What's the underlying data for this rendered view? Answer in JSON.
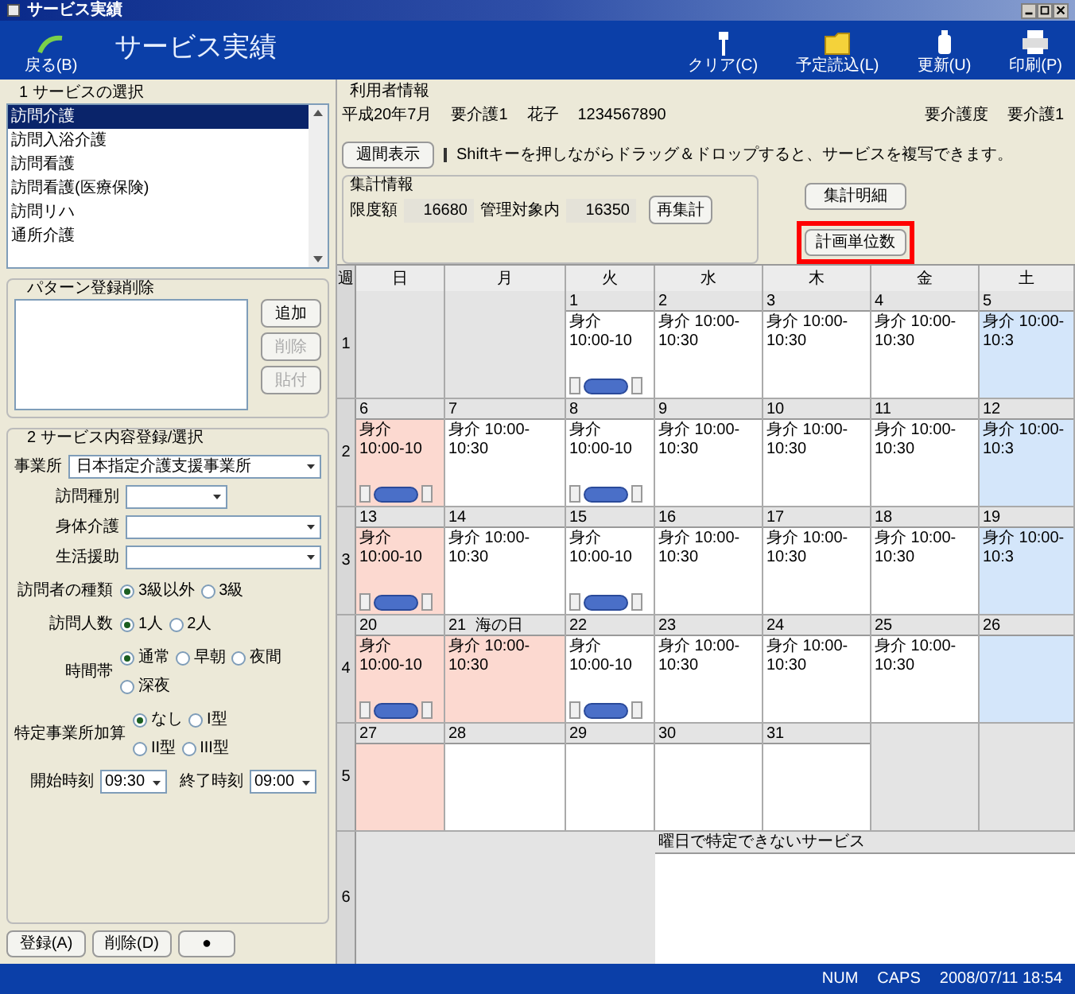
{
  "window": {
    "title": "サービス実績"
  },
  "toolbar": {
    "back": "戻る(B)",
    "title": "サービス実績",
    "buttons": [
      {
        "label": "クリア(C)",
        "kind": "clear"
      },
      {
        "label": "予定読込(L)",
        "kind": "folder"
      },
      {
        "label": "更新(U)",
        "kind": "update"
      },
      {
        "label": "印刷(P)",
        "kind": "print"
      }
    ]
  },
  "service_select": {
    "heading": "1 サービスの選択",
    "items": [
      {
        "label": "訪問介護",
        "selected": true
      },
      {
        "label": "訪問入浴介護",
        "selected": false
      },
      {
        "label": "訪問看護",
        "selected": false
      },
      {
        "label": "訪問看護(医療保険)",
        "selected": false
      },
      {
        "label": "訪問リハ",
        "selected": false
      },
      {
        "label": "通所介護",
        "selected": false
      }
    ]
  },
  "pattern": {
    "heading": "パターン登録削除",
    "buttons": [
      {
        "label": "追加",
        "disabled": false
      },
      {
        "label": "削除",
        "disabled": true
      },
      {
        "label": "貼付",
        "disabled": true
      }
    ]
  },
  "service_content": {
    "heading": "2 サービス内容登録/選択",
    "office": {
      "label": "事業所",
      "value": "日本指定介護支援事業所"
    },
    "selects": [
      {
        "label": "訪問種別",
        "kind": "short"
      },
      {
        "label": "身体介護",
        "kind": "wide"
      },
      {
        "label": "生活援助",
        "kind": "wide"
      }
    ],
    "radio_groups": [
      {
        "label": "訪問者の種類",
        "options": [
          {
            "label": "3級以外",
            "selected": true
          },
          {
            "label": "3級",
            "selected": false
          }
        ]
      },
      {
        "label": "訪問人数",
        "options": [
          {
            "label": "1人",
            "selected": true
          },
          {
            "label": "2人",
            "selected": false
          }
        ]
      },
      {
        "label": "時間帯",
        "options": [
          {
            "label": "通常",
            "selected": true
          },
          {
            "label": "早朝",
            "selected": false
          },
          {
            "label": "夜間",
            "selected": false
          },
          {
            "label": "深夜",
            "selected": false
          }
        ]
      },
      {
        "label": "特定事業所加算",
        "options": [
          {
            "label": "なし",
            "selected": true
          },
          {
            "label": "I型",
            "selected": false
          },
          {
            "label": "II型",
            "selected": false
          },
          {
            "label": "III型",
            "selected": false
          }
        ]
      }
    ],
    "times": [
      {
        "label": "開始時刻",
        "value": "09:30"
      },
      {
        "label": "終了時刻",
        "value": "09:00"
      }
    ]
  },
  "bottom_buttons": [
    "登録(A)",
    "削除(D)",
    "●"
  ],
  "user_info": {
    "heading": "利用者情報",
    "fields": [
      "平成20年7月",
      "要介護1",
      "花子",
      "1234567890"
    ],
    "care_level_label": "要介護度",
    "care_level": "要介護1"
  },
  "week_view_button": "週間表示",
  "hint": "Shiftキーを押しながらドラッグ＆ドロップすると、サービスを複写できます。",
  "totals": {
    "heading": "集計情報",
    "items": [
      {
        "label": "限度額",
        "value": "16680"
      },
      {
        "label": "管理対象内",
        "value": "16350"
      }
    ],
    "recalc_button": "再集計"
  },
  "side_buttons": [
    {
      "label": "集計明細",
      "highlighted": false
    },
    {
      "label": "計画単位数",
      "highlighted": true
    }
  ],
  "calendar": {
    "week_header": "週",
    "weekdays": [
      "日",
      "月",
      "火",
      "水",
      "木",
      "金",
      "土"
    ],
    "weeks": [
      {
        "label": "1",
        "days": [
          {
            "kind": "empty"
          },
          {
            "kind": "empty"
          },
          {
            "date": "1",
            "entry": "身介 10:00-10",
            "kind": "weekday",
            "scroller": true
          },
          {
            "date": "2",
            "entry": "身介 10:00-10:30",
            "kind": "weekday",
            "scroller": false
          },
          {
            "date": "3",
            "entry": "身介 10:00-10:30",
            "kind": "weekday",
            "scroller": false
          },
          {
            "date": "4",
            "entry": "身介 10:00-10:30",
            "kind": "weekday",
            "scroller": false
          },
          {
            "date": "5",
            "entry": "身介 10:00-10:3",
            "kind": "saturday",
            "scroller": false
          }
        ]
      },
      {
        "label": "2",
        "days": [
          {
            "date": "6",
            "entry": "身介 10:00-10",
            "kind": "holiday",
            "scroller": true
          },
          {
            "date": "7",
            "entry": "身介 10:00-10:30",
            "kind": "weekday",
            "scroller": false
          },
          {
            "date": "8",
            "entry": "身介 10:00-10",
            "kind": "weekday",
            "scroller": true
          },
          {
            "date": "9",
            "entry": "身介 10:00-10:30",
            "kind": "weekday",
            "scroller": false
          },
          {
            "date": "10",
            "entry": "身介 10:00-10:30",
            "kind": "weekday",
            "scroller": false
          },
          {
            "date": "11",
            "entry": "身介 10:00-10:30",
            "kind": "weekday",
            "scroller": false
          },
          {
            "date": "12",
            "entry": "身介 10:00-10:3",
            "kind": "saturday",
            "scroller": false
          }
        ]
      },
      {
        "label": "3",
        "days": [
          {
            "date": "13",
            "entry": "身介 10:00-10",
            "kind": "holiday",
            "scroller": true
          },
          {
            "date": "14",
            "entry": "身介 10:00-10:30",
            "kind": "weekday",
            "scroller": false
          },
          {
            "date": "15",
            "entry": "身介 10:00-10",
            "kind": "weekday",
            "scroller": true
          },
          {
            "date": "16",
            "entry": "身介 10:00-10:30",
            "kind": "weekday",
            "scroller": false
          },
          {
            "date": "17",
            "entry": "身介 10:00-10:30",
            "kind": "weekday",
            "scroller": false
          },
          {
            "date": "18",
            "entry": "身介 10:00-10:30",
            "kind": "weekday",
            "scroller": false
          },
          {
            "date": "19",
            "entry": "身介 10:00-10:3",
            "kind": "saturday",
            "scroller": false
          }
        ]
      },
      {
        "label": "4",
        "days": [
          {
            "date": "20",
            "entry": "身介 10:00-10",
            "kind": "holiday",
            "scroller": true
          },
          {
            "date": "21",
            "note": "海の日",
            "entry": "身介 10:00-10:30",
            "kind": "holiday",
            "scroller": false
          },
          {
            "date": "22",
            "entry": "身介 10:00-10",
            "kind": "weekday",
            "scroller": true
          },
          {
            "date": "23",
            "entry": "身介 10:00-10:30",
            "kind": "weekday",
            "scroller": false
          },
          {
            "date": "24",
            "entry": "身介 10:00-10:30",
            "kind": "weekday",
            "scroller": false
          },
          {
            "date": "25",
            "entry": "身介 10:00-10:30",
            "kind": "weekday",
            "scroller": false
          },
          {
            "date": "26",
            "kind": "saturday",
            "scroller": false
          }
        ]
      },
      {
        "label": "5",
        "days": [
          {
            "date": "27",
            "kind": "holiday",
            "scroller": false
          },
          {
            "date": "28",
            "kind": "weekday",
            "scroller": false
          },
          {
            "date": "29",
            "kind": "weekday",
            "scroller": false
          },
          {
            "date": "30",
            "kind": "weekday",
            "scroller": false
          },
          {
            "date": "31",
            "kind": "weekday",
            "scroller": false
          },
          {
            "kind": "empty"
          },
          {
            "kind": "empty"
          }
        ]
      }
    ],
    "extra_row": {
      "label": "6",
      "title": "曜日で特定できないサービス"
    }
  },
  "status_bar": [
    "NUM",
    "CAPS",
    "2008/07/11 18:54"
  ]
}
